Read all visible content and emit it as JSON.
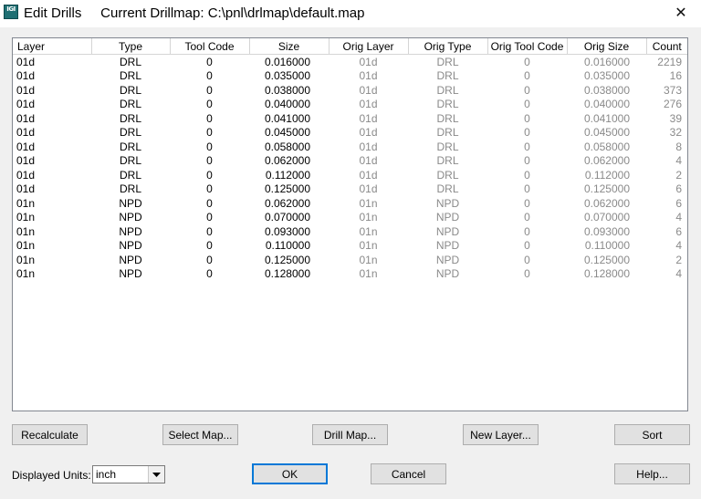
{
  "window": {
    "icon_text": "IGI",
    "title": "Edit Drills     Current Drillmap: C:\\pnl\\drlmap\\default.map"
  },
  "table": {
    "headers": [
      "Layer",
      "Type",
      "Tool Code",
      "Size",
      "Orig Layer",
      "Orig Type",
      "Orig Tool Code",
      "Orig Size",
      "Count"
    ],
    "rows": [
      [
        "01d",
        "DRL",
        "0",
        "0.016000",
        "01d",
        "DRL",
        "0",
        "0.016000",
        "2219"
      ],
      [
        "01d",
        "DRL",
        "0",
        "0.035000",
        "01d",
        "DRL",
        "0",
        "0.035000",
        "16"
      ],
      [
        "01d",
        "DRL",
        "0",
        "0.038000",
        "01d",
        "DRL",
        "0",
        "0.038000",
        "373"
      ],
      [
        "01d",
        "DRL",
        "0",
        "0.040000",
        "01d",
        "DRL",
        "0",
        "0.040000",
        "276"
      ],
      [
        "01d",
        "DRL",
        "0",
        "0.041000",
        "01d",
        "DRL",
        "0",
        "0.041000",
        "39"
      ],
      [
        "01d",
        "DRL",
        "0",
        "0.045000",
        "01d",
        "DRL",
        "0",
        "0.045000",
        "32"
      ],
      [
        "01d",
        "DRL",
        "0",
        "0.058000",
        "01d",
        "DRL",
        "0",
        "0.058000",
        "8"
      ],
      [
        "01d",
        "DRL",
        "0",
        "0.062000",
        "01d",
        "DRL",
        "0",
        "0.062000",
        "4"
      ],
      [
        "01d",
        "DRL",
        "0",
        "0.112000",
        "01d",
        "DRL",
        "0",
        "0.112000",
        "2"
      ],
      [
        "01d",
        "DRL",
        "0",
        "0.125000",
        "01d",
        "DRL",
        "0",
        "0.125000",
        "6"
      ],
      [
        "01n",
        "NPD",
        "0",
        "0.062000",
        "01n",
        "NPD",
        "0",
        "0.062000",
        "6"
      ],
      [
        "01n",
        "NPD",
        "0",
        "0.070000",
        "01n",
        "NPD",
        "0",
        "0.070000",
        "4"
      ],
      [
        "01n",
        "NPD",
        "0",
        "0.093000",
        "01n",
        "NPD",
        "0",
        "0.093000",
        "6"
      ],
      [
        "01n",
        "NPD",
        "0",
        "0.110000",
        "01n",
        "NPD",
        "0",
        "0.110000",
        "4"
      ],
      [
        "01n",
        "NPD",
        "0",
        "0.125000",
        "01n",
        "NPD",
        "0",
        "0.125000",
        "2"
      ],
      [
        "01n",
        "NPD",
        "0",
        "0.128000",
        "01n",
        "NPD",
        "0",
        "0.128000",
        "4"
      ]
    ]
  },
  "buttons": {
    "recalculate": "Recalculate",
    "select_map": "Select Map...",
    "drill_map": "Drill Map...",
    "new_layer": "New Layer...",
    "sort": "Sort",
    "ok": "OK",
    "cancel": "Cancel",
    "help": "Help..."
  },
  "units": {
    "label": "Displayed Units:",
    "value": "inch"
  }
}
